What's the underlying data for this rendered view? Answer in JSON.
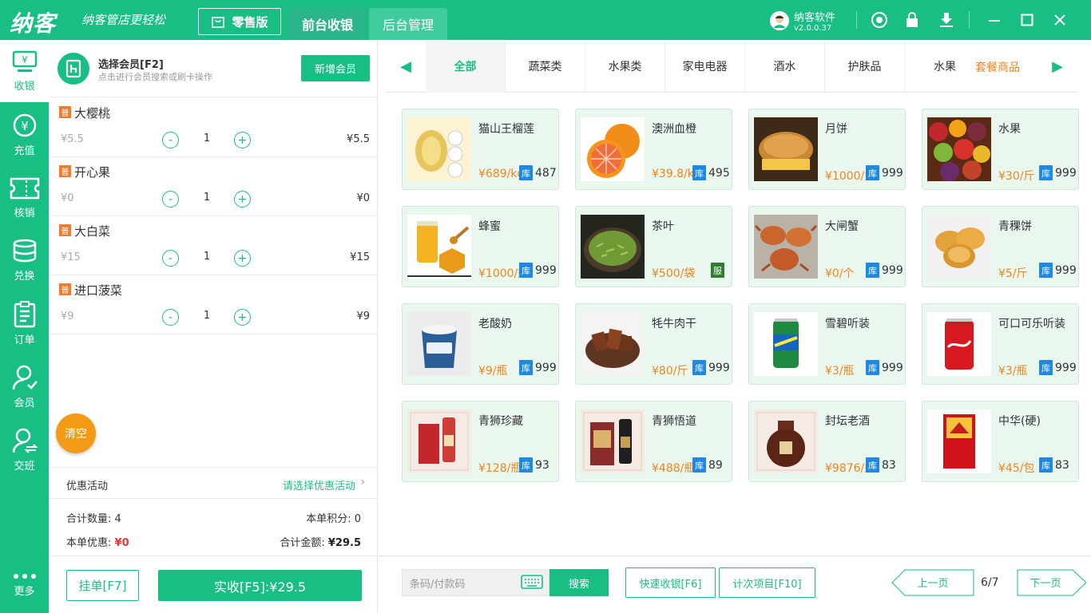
{
  "header": {
    "logo": "纳客",
    "slogan": "纳客管店更轻松",
    "edition": "零售版",
    "tabs": [
      "前台收银",
      "后台管理"
    ],
    "user_name": "纳客软件",
    "version": "v2.0.0.37"
  },
  "sidebar": [
    {
      "label": "收银",
      "icon": "cashier-icon"
    },
    {
      "label": "充值",
      "icon": "recharge-icon"
    },
    {
      "label": "核销",
      "icon": "ticket-icon"
    },
    {
      "label": "兑换",
      "icon": "exchange-icon"
    },
    {
      "label": "订单",
      "icon": "order-icon"
    },
    {
      "label": "会员",
      "icon": "member-icon"
    },
    {
      "label": "交班",
      "icon": "shift-icon"
    },
    {
      "label": "更多",
      "icon": "more-icon"
    }
  ],
  "member": {
    "title": "选择会员[F2]",
    "hint": "点击进行会员搜索或刷卡操作",
    "add_label": "新增会员"
  },
  "cart": [
    {
      "badge": "普",
      "name": "大樱桃",
      "price": "¥5.5",
      "qty": "1",
      "total": "¥5.5"
    },
    {
      "badge": "普",
      "name": "开心果",
      "price": "¥0",
      "qty": "1",
      "total": "¥0"
    },
    {
      "badge": "普",
      "name": "大白菜",
      "price": "¥15",
      "qty": "1",
      "total": "¥15"
    },
    {
      "badge": "普",
      "name": "进口菠菜",
      "price": "¥9",
      "qty": "1",
      "total": "¥9"
    }
  ],
  "qty_minus": "-",
  "qty_plus": "+",
  "clear_label": "清空",
  "promo": {
    "label": "优惠活动",
    "select": "请选择优惠活动"
  },
  "summary": {
    "qty_label": "合计数量:",
    "qty": "4",
    "points_label": "本单积分:",
    "points": "0",
    "discount_label": "本单优惠:",
    "discount": "¥0",
    "amount_label": "合计金额:",
    "amount": "¥29.5"
  },
  "actions": {
    "hold": "挂单[F7]",
    "pay": "实收[F5]:¥29.5"
  },
  "categories": [
    "全部",
    "蔬菜类",
    "水果类",
    "家电电器",
    "酒水",
    "护肤品",
    "水果"
  ],
  "category_extra": "套餐商品",
  "products": [
    {
      "name": "猫山王榴莲",
      "price": "¥689/kg",
      "stock_badge": "库",
      "stock": "487",
      "img": "durian"
    },
    {
      "name": "澳洲血橙",
      "price": "¥39.8/kg",
      "stock_badge": "库",
      "stock": "495",
      "img": "orange"
    },
    {
      "name": "月饼",
      "price": "¥1000/盒",
      "stock_badge": "库",
      "stock": "999",
      "img": "mooncake"
    },
    {
      "name": "水果",
      "price": "¥30/斤",
      "stock_badge": "库",
      "stock": "999",
      "img": "fruit"
    },
    {
      "name": "蜂蜜",
      "price": "¥1000/瓶",
      "stock_badge": "库",
      "stock": "999",
      "img": "honey"
    },
    {
      "name": "茶叶",
      "price": "¥500/袋",
      "stock_badge": "服",
      "stock": "",
      "img": "tea"
    },
    {
      "name": "大闸蟹",
      "price": "¥0/个",
      "stock_badge": "库",
      "stock": "999",
      "img": "crab"
    },
    {
      "name": "青稞饼",
      "price": "¥5/斤",
      "stock_badge": "库",
      "stock": "999",
      "img": "cookie"
    },
    {
      "name": "老酸奶",
      "price": "¥9/瓶",
      "stock_badge": "库",
      "stock": "999",
      "img": "yogurt"
    },
    {
      "name": "牦牛肉干",
      "price": "¥80/斤",
      "stock_badge": "库",
      "stock": "999",
      "img": "beef"
    },
    {
      "name": "雪碧听装",
      "price": "¥3/瓶",
      "stock_badge": "库",
      "stock": "999",
      "img": "sprite"
    },
    {
      "name": "可口可乐听装",
      "price": "¥3/瓶",
      "stock_badge": "库",
      "stock": "999",
      "img": "cola"
    },
    {
      "name": "青狮珍藏",
      "price": "¥128/瓶",
      "stock_badge": "库",
      "stock": "93",
      "img": "wine1"
    },
    {
      "name": "青狮悟道",
      "price": "¥488/瓶",
      "stock_badge": "库",
      "stock": "89",
      "img": "wine2"
    },
    {
      "name": "封坛老酒",
      "price": "¥9876/瓶",
      "stock_badge": "库",
      "stock": "83",
      "img": "jar"
    },
    {
      "name": "中华(硬)",
      "price": "¥45/包",
      "stock_badge": "库",
      "stock": "83",
      "img": "cigarette"
    }
  ],
  "bottom": {
    "barcode_placeholder": "条码/付款码",
    "search": "搜索",
    "quick_pay": "快速收银[F6]",
    "count_items": "计次项目[F10]",
    "prev": "上一页",
    "next": "下一页",
    "page": "6/7"
  },
  "colors": {
    "primary": "#19be83",
    "orange": "#f0841c",
    "stock_blue": "#1e88e5",
    "service_green": "#2e7d32",
    "badge": "#f07c2e"
  }
}
